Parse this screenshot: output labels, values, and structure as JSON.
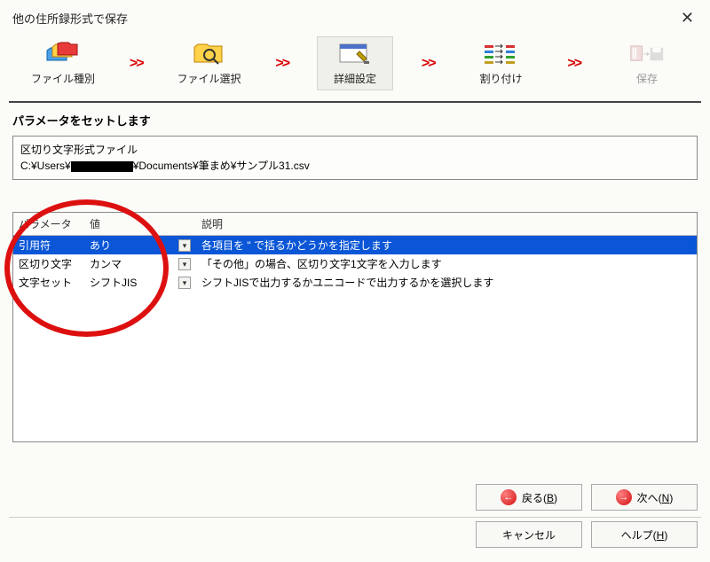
{
  "title": "他の住所録形式で保存",
  "wizard": {
    "steps": [
      {
        "label": "ファイル種別"
      },
      {
        "label": "ファイル選択"
      },
      {
        "label": "詳細設定"
      },
      {
        "label": "割り付け"
      },
      {
        "label": "保存"
      }
    ],
    "chevron": ">>"
  },
  "subheading": "パラメータをセットします",
  "fileinfo": {
    "line1": "区切り文字形式ファイル",
    "path_prefix": "C:¥Users¥",
    "path_suffix": "¥Documents¥筆まめ¥サンプル31.csv"
  },
  "table": {
    "headers": {
      "param": "パラメータ",
      "value": "値",
      "desc": "説明"
    },
    "rows": [
      {
        "param": "引用符",
        "value": "あり",
        "desc": "各項目を \" で括るかどうかを指定します",
        "selected": true
      },
      {
        "param": "区切り文字",
        "value": "カンマ",
        "desc": "「その他」の場合、区切り文字1文字を入力します",
        "selected": false
      },
      {
        "param": "文字セット",
        "value": "シフトJIS",
        "desc": "シフトJISで出力するかユニコードで出力するかを選択します",
        "selected": false
      }
    ]
  },
  "buttons": {
    "back_icon": "←",
    "back_text": "戻る(",
    "back_key": "B",
    "next_icon": "→",
    "next_text": "次へ(",
    "next_key": "N",
    "paren_close": ")",
    "cancel": "キャンセル",
    "help_text": "ヘルプ(",
    "help_key": "H"
  }
}
